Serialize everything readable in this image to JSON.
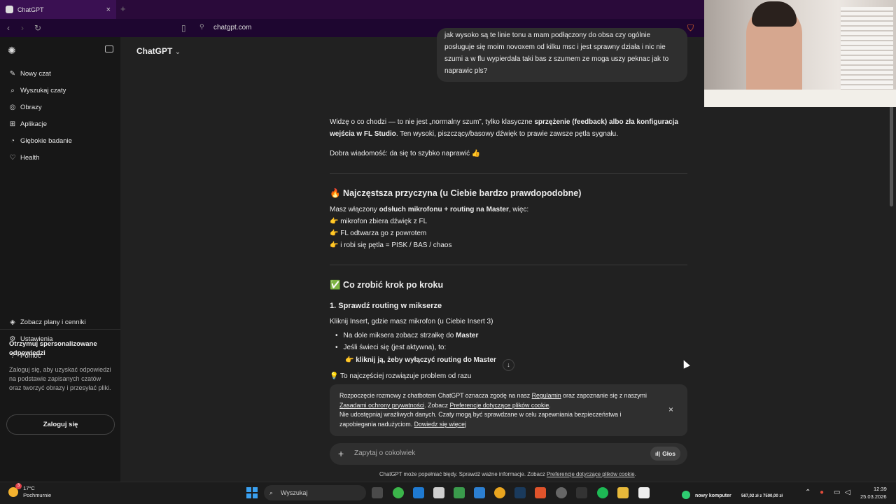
{
  "browser": {
    "tab_title": "ChatGPT",
    "tab_close": "×",
    "new_tab": "+",
    "url": "chatgpt.com"
  },
  "sidebar": {
    "items": [
      {
        "label": "Nowy czat",
        "icon": "edit-icon",
        "glyph": "✎"
      },
      {
        "label": "Wyszukaj czaty",
        "icon": "search-icon",
        "glyph": "⌕"
      },
      {
        "label": "Obrazy",
        "icon": "image-icon",
        "glyph": "◎"
      },
      {
        "label": "Aplikacje",
        "icon": "apps-icon",
        "glyph": "⊞"
      },
      {
        "label": "Głębokie badanie",
        "icon": "telescope-icon",
        "glyph": "◔"
      },
      {
        "label": "Health",
        "icon": "heart-icon",
        "glyph": "♡"
      }
    ],
    "bottom_items": [
      {
        "label": "Zobacz plany i cenniki",
        "icon": "plans-icon",
        "glyph": "◈"
      },
      {
        "label": "Ustawienia",
        "icon": "gear-icon",
        "glyph": "⚙"
      },
      {
        "label": "Pomoc",
        "icon": "help-icon",
        "glyph": "?"
      }
    ],
    "promo_title": "Otrzymuj spersonalizowane odpowiedzi",
    "promo_text": "Zaloguj się, aby uzyskać odpowiedzi na podstawie zapisanych czatów oraz tworzyć obrazy i przesyłać pliki.",
    "login_label": "Zaloguj się"
  },
  "header": {
    "title": "ChatGPT",
    "chevron": "⌄"
  },
  "user_message": {
    "text": "jak wysoko są te linie tonu a mam podłączony do obsa czy ogólnie posługuje się moim novoxem od kilku msc i jest sprawny działa i nic nie szumi a w flu wypierdala taki bas z szumem ze moga uszy peknac jak to naprawic pls?"
  },
  "assistant": {
    "intro_1a": "Widzę o co chodzi — to nie jest „normalny szum”, tylko klasyczne ",
    "intro_1b": "sprzężenie (feedback) albo zła konfiguracja wejścia w FL Studio",
    "intro_1c": ". Ten wysoki, piszczący/basowy dźwięk to prawie zawsze pętla sygnału.",
    "intro_2": "Dobra wiadomość: da się to szybko naprawić 👍",
    "section1_title": "🔥 Najczęstsza przyczyna (u Ciebie bardzo prawdopodobne)",
    "section1_line_a": "Masz włączony ",
    "section1_line_b": "odsłuch mikrofonu + routing na Master",
    "section1_line_c": ", więc:",
    "section1_points": [
      "👉 mikrofon zbiera dźwięk z FL",
      "👉 FL odtwarza go z powrotem",
      "👉 i robi się pętla = PISK / BAS / chaos"
    ],
    "section2_title": "✅ Co zrobić krok po kroku",
    "step1_title": "1. Sprawdź routing w mikserze",
    "step1_text": "Kliknij Insert, gdzie masz mikrofon (u Ciebie Insert 3)",
    "step1_bullet1a": "Na dole miksera zobacz strzałkę do ",
    "step1_bullet1b": "Master",
    "step1_bullet2": "Jeśli świeci się (jest aktywna), to:",
    "step1_sub": "👉 kliknij ją, żeby wyłączyć routing do Master",
    "tip": "💡 To najczęściej rozwiązuje problem od razu"
  },
  "cookie": {
    "l1a": "Rozpoczęcie rozmowy z chatbotem ChatGPT oznacza zgodę na nasz ",
    "l1b": "Regulamin",
    "l1c": " oraz zapoznanie się z naszymi",
    "l2a": "Zasadami ochrony prywatności",
    "l2b": ". Zobacz ",
    "l2c": "Preferencje dotyczące plików cookie",
    "l2d": ".",
    "l3": "Nie udostępniaj wrażliwych danych. Czaty mogą być sprawdzane w celu zapewniania bezpieczeństwa i",
    "l4a": "zapobiegania nadużyciom. ",
    "l4b": "Dowiedz się więcej",
    "close": "×"
  },
  "composer": {
    "placeholder": "Zapytaj o cokolwiek",
    "plus": "+",
    "voice_label": "Głos"
  },
  "footer": {
    "text_a": "ChatGPT może popełniać błędy. Sprawdź ważne informacje. Zobacz ",
    "text_b": "Preferencje dotyczące plików cookie",
    "text_c": "."
  },
  "taskbar": {
    "temp": "17°C",
    "weather": "Pochmurnie",
    "weather_badge": "3",
    "search": "Wyszukaj",
    "tray_app": "nowy komputer",
    "tray_money": "567,02 zł z 7500,00 zł",
    "time": "12:39",
    "date": "25.03.2026"
  },
  "scroll_down": "↓"
}
